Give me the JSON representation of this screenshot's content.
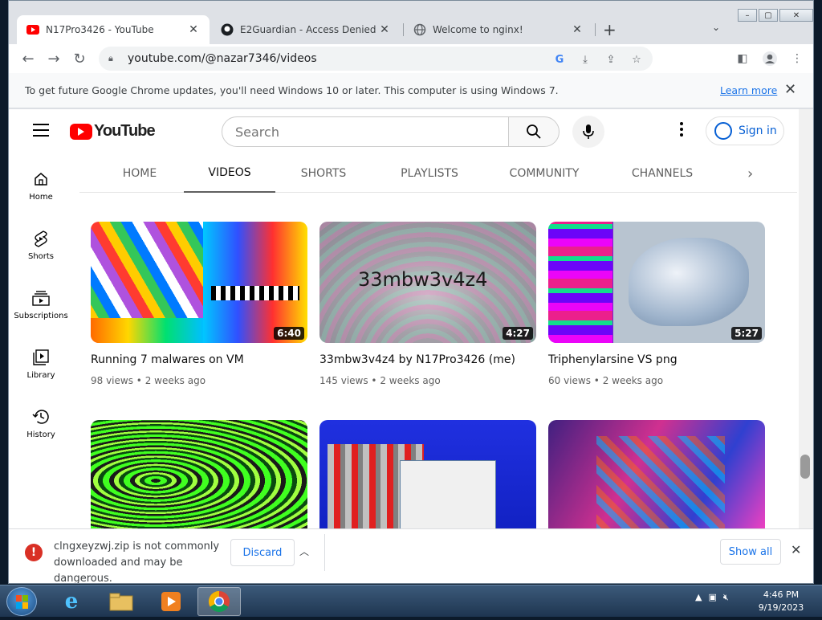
{
  "browser": {
    "tabs": [
      {
        "title": "N17Pro3426 - YouTube",
        "icon": "youtube-favicon-icon",
        "active": true
      },
      {
        "title": "E2Guardian - Access Denied",
        "icon": "github-favicon-icon",
        "active": false
      },
      {
        "title": "Welcome to nginx!",
        "icon": "globe-favicon-icon",
        "active": false
      }
    ],
    "url": "youtube.com/@nazar7346/videos"
  },
  "infobar": {
    "message": "To get future Google Chrome updates, you'll need Windows 10 or later. This computer is using Windows 7.",
    "link": "Learn more"
  },
  "youtube": {
    "logo_text": "YouTube",
    "search_placeholder": "Search",
    "signin": "Sign in",
    "sidebar": [
      {
        "label": "Home",
        "icon": "home-icon"
      },
      {
        "label": "Shorts",
        "icon": "shorts-icon"
      },
      {
        "label": "Subscriptions",
        "icon": "subscriptions-icon"
      },
      {
        "label": "Library",
        "icon": "library-icon"
      },
      {
        "label": "History",
        "icon": "history-icon"
      }
    ],
    "channel_tabs": [
      "HOME",
      "VIDEOS",
      "SHORTS",
      "PLAYLISTS",
      "COMMUNITY",
      "CHANNELS"
    ],
    "selected_tab": "VIDEOS",
    "videos": [
      {
        "title": "Running 7 malwares on VM",
        "views": "98 views",
        "age": "2 weeks ago",
        "duration": "6:40"
      },
      {
        "title": "33mbw3v4z4 by N17Pro3426 (me)",
        "views": "145 views",
        "age": "2 weeks ago",
        "duration": "4:27",
        "thumb_text": "33mbw3v4z4"
      },
      {
        "title": "Triphenylarsine VS png",
        "views": "60 views",
        "age": "2 weeks ago",
        "duration": "5:27"
      }
    ]
  },
  "download": {
    "text": "clngxeyzwj.zip is not commonly downloaded and may be dangerous.",
    "discard": "Discard",
    "show_all": "Show all"
  },
  "taskbar": {
    "time": "4:46 PM",
    "date": "9/19/2023"
  },
  "colors": {
    "yt_red": "#ff0000",
    "link_blue": "#1a73e8",
    "warn_red": "#d93025"
  }
}
